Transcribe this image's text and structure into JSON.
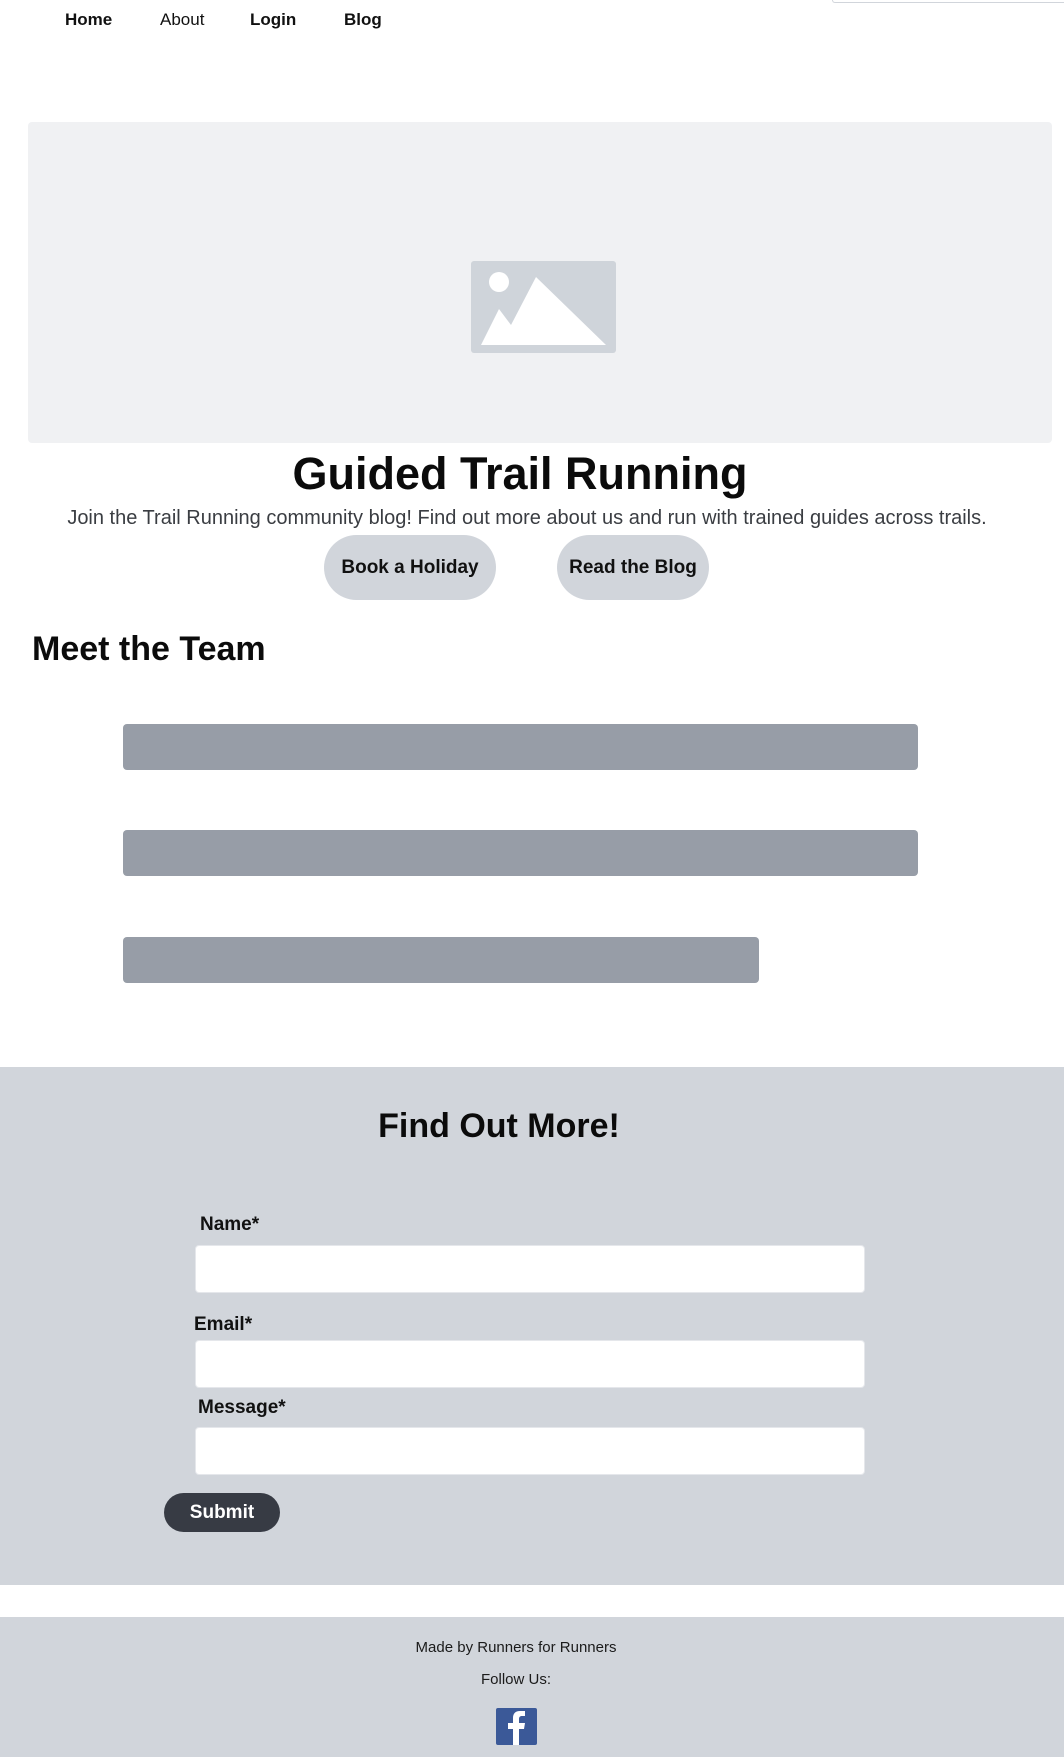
{
  "nav": {
    "items": [
      {
        "label": "Home"
      },
      {
        "label": "About"
      },
      {
        "label": "Login"
      },
      {
        "label": "Blog"
      }
    ]
  },
  "hero": {
    "image_icon": "image-placeholder-icon",
    "title": "Guided Trail Running",
    "subtitle": "Join the Trail Running community blog! Find out more about us and run with trained guides across trails.",
    "buttons": {
      "book": "Book a Holiday",
      "read": "Read the Blog"
    }
  },
  "team": {
    "title": "Meet the Team"
  },
  "contact": {
    "title": "Find Out More!",
    "fields": {
      "name_label": "Name*",
      "email_label": "Email*",
      "message_label": "Message*",
      "name_value": "",
      "email_value": "",
      "message_value": ""
    },
    "submit": "Submit"
  },
  "footer": {
    "made_by": "Made by Runners for Runners",
    "follow": "Follow Us:",
    "social_icon": "facebook-icon"
  },
  "colors": {
    "section_gray": "#d1d5db",
    "placeholder_bar": "#979da7",
    "hero_bg": "#f0f1f3",
    "submit_bg": "#373b44",
    "facebook_blue": "#3b5998"
  }
}
